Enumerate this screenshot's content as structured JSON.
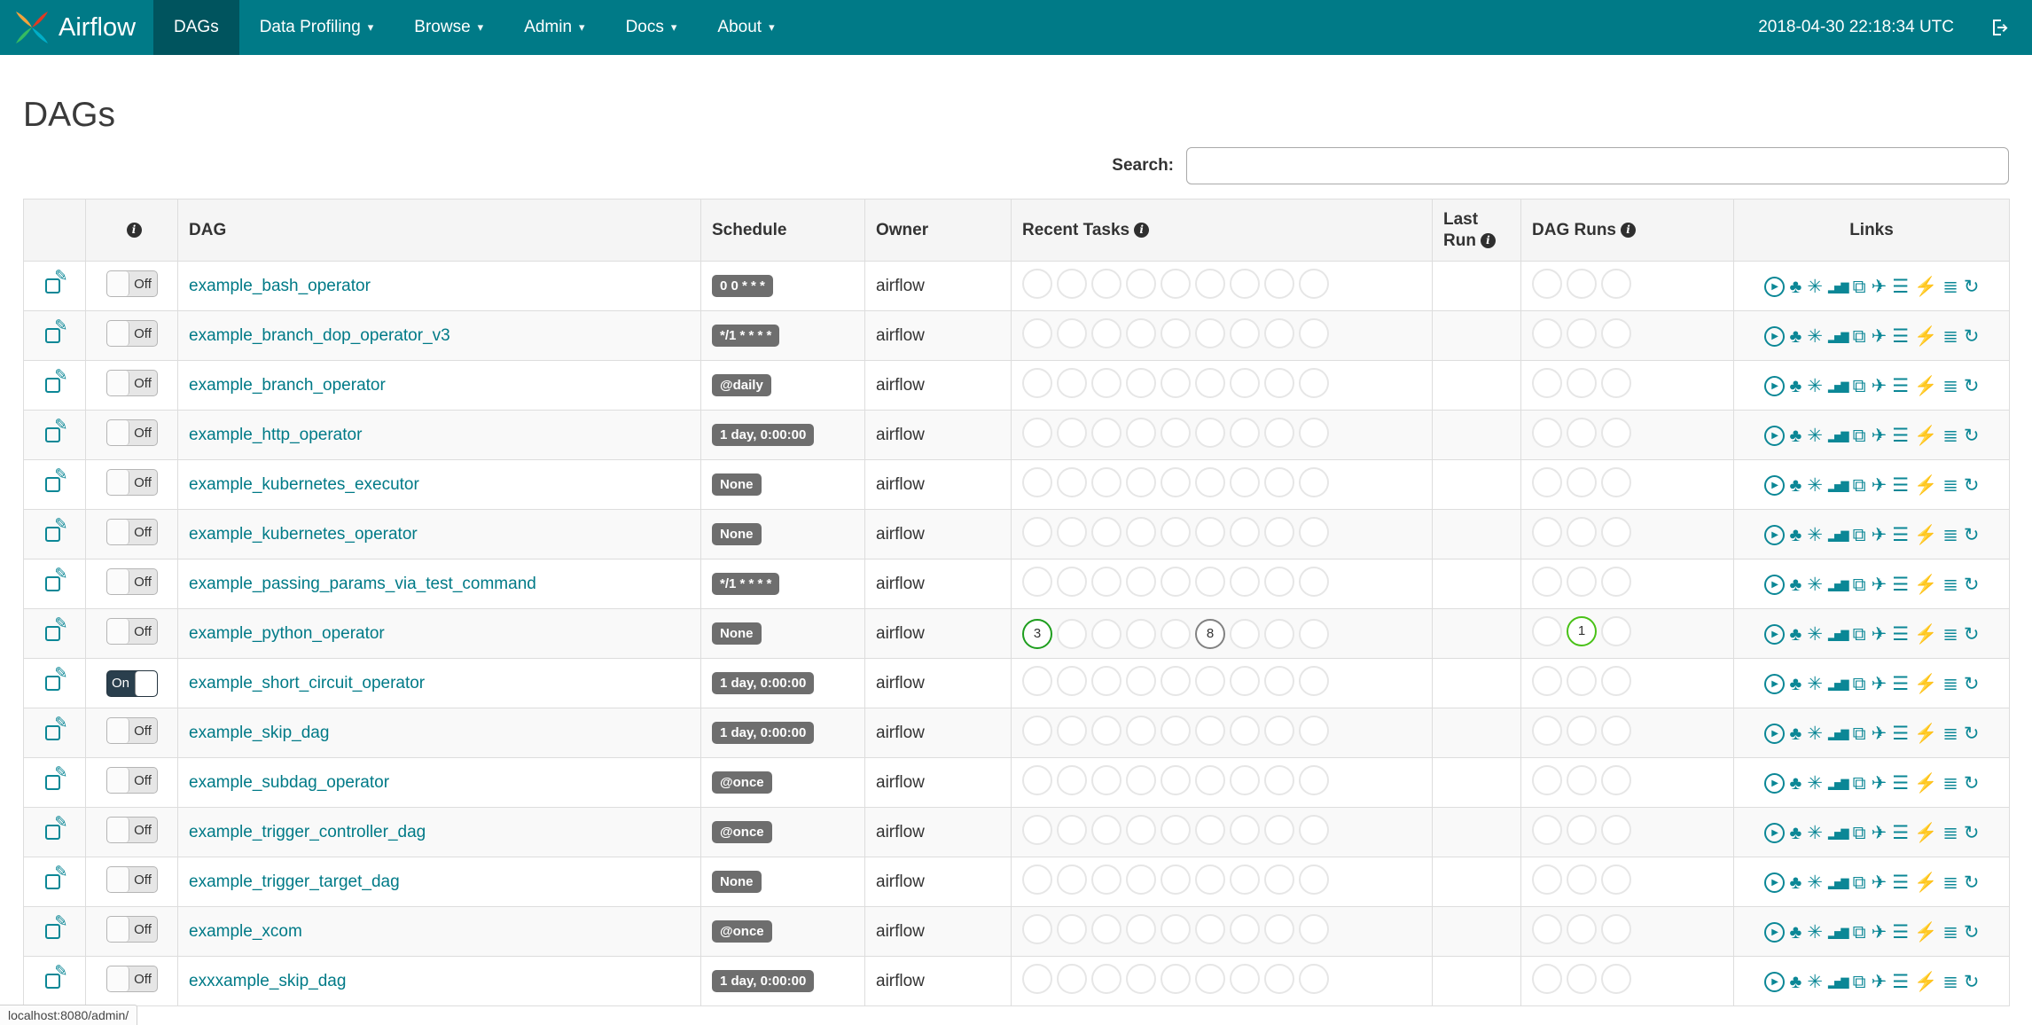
{
  "colors": {
    "navbar_bg": "#007A87",
    "navbar_active_bg": "#00545E",
    "link_teal": "#007A87",
    "icon_teal": "#0B8796",
    "badge_gray": "#6E6E6E",
    "toggle_on_bg": "#2A3F4D",
    "circle_empty_border": "#E6E6E6",
    "success_green": "#1E9E1E",
    "running_green": "#49C117",
    "queued_gray": "#828282"
  },
  "navbar": {
    "brand": "Airflow",
    "items": [
      {
        "label": "DAGs",
        "active": true,
        "dropdown": false
      },
      {
        "label": "Data Profiling",
        "active": false,
        "dropdown": true
      },
      {
        "label": "Browse",
        "active": false,
        "dropdown": true
      },
      {
        "label": "Admin",
        "active": false,
        "dropdown": true
      },
      {
        "label": "Docs",
        "active": false,
        "dropdown": true
      },
      {
        "label": "About",
        "active": false,
        "dropdown": true
      }
    ],
    "clock": "2018-04-30 22:18:34 UTC"
  },
  "page_title": "DAGs",
  "search": {
    "label": "Search:",
    "value": ""
  },
  "icons": {
    "info": "i",
    "caret": "▾",
    "edit": "✎"
  },
  "table": {
    "columns": [
      {
        "key": "edit",
        "label": "",
        "info": false
      },
      {
        "key": "toggle",
        "label": "",
        "info": true
      },
      {
        "key": "dag",
        "label": "DAG",
        "info": false
      },
      {
        "key": "schedule",
        "label": "Schedule",
        "info": false
      },
      {
        "key": "owner",
        "label": "Owner",
        "info": false
      },
      {
        "key": "recent",
        "label": "Recent Tasks",
        "info": true
      },
      {
        "key": "lastrun",
        "label": "Last Run",
        "info": true
      },
      {
        "key": "dagruns",
        "label": "DAG Runs",
        "info": true
      },
      {
        "key": "links",
        "label": "Links",
        "info": false
      }
    ],
    "recent_task_slots": 9,
    "dag_run_slots": 3,
    "link_icons": [
      {
        "name": "play-circle-icon",
        "glyph": "▶",
        "circled": true
      },
      {
        "name": "tree-icon",
        "glyph": "♣"
      },
      {
        "name": "graph-starburst-icon",
        "glyph": "✳"
      },
      {
        "name": "bar-chart-icon",
        "glyph": "▂▅▇",
        "small": true
      },
      {
        "name": "books-icon",
        "glyph": "⧉"
      },
      {
        "name": "plane-icon",
        "glyph": "✈"
      },
      {
        "name": "align-left-icon",
        "glyph": "☰"
      },
      {
        "name": "lightning-icon",
        "glyph": "⚡"
      },
      {
        "name": "list-lines-icon",
        "glyph": "≣"
      },
      {
        "name": "refresh-icon",
        "glyph": "↻"
      }
    ],
    "rows": [
      {
        "dag": "example_bash_operator",
        "toggle": "Off",
        "schedule": "0 0 * * *",
        "owner": "airflow",
        "recent_tasks": {},
        "dag_runs": {}
      },
      {
        "dag": "example_branch_dop_operator_v3",
        "toggle": "Off",
        "schedule": "*/1 * * * *",
        "owner": "airflow",
        "recent_tasks": {},
        "dag_runs": {}
      },
      {
        "dag": "example_branch_operator",
        "toggle": "Off",
        "schedule": "@daily",
        "owner": "airflow",
        "recent_tasks": {},
        "dag_runs": {}
      },
      {
        "dag": "example_http_operator",
        "toggle": "Off",
        "schedule": "1 day, 0:00:00",
        "owner": "airflow",
        "recent_tasks": {},
        "dag_runs": {}
      },
      {
        "dag": "example_kubernetes_executor",
        "toggle": "Off",
        "schedule": "None",
        "owner": "airflow",
        "recent_tasks": {},
        "dag_runs": {}
      },
      {
        "dag": "example_kubernetes_operator",
        "toggle": "Off",
        "schedule": "None",
        "owner": "airflow",
        "recent_tasks": {},
        "dag_runs": {}
      },
      {
        "dag": "example_passing_params_via_test_command",
        "toggle": "Off",
        "schedule": "*/1 * * * *",
        "owner": "airflow",
        "recent_tasks": {},
        "dag_runs": {}
      },
      {
        "dag": "example_python_operator",
        "toggle": "Off",
        "schedule": "None",
        "owner": "airflow",
        "recent_tasks": {
          "0": {
            "count": "3",
            "color": "#1E9E1E"
          },
          "5": {
            "count": "8",
            "color": "#828282"
          }
        },
        "dag_runs": {
          "1": {
            "count": "1",
            "color": "#49C117"
          }
        }
      },
      {
        "dag": "example_short_circuit_operator",
        "toggle": "On",
        "schedule": "1 day, 0:00:00",
        "owner": "airflow",
        "recent_tasks": {},
        "dag_runs": {}
      },
      {
        "dag": "example_skip_dag",
        "toggle": "Off",
        "schedule": "1 day, 0:00:00",
        "owner": "airflow",
        "recent_tasks": {},
        "dag_runs": {}
      },
      {
        "dag": "example_subdag_operator",
        "toggle": "Off",
        "schedule": "@once",
        "owner": "airflow",
        "recent_tasks": {},
        "dag_runs": {}
      },
      {
        "dag": "example_trigger_controller_dag",
        "toggle": "Off",
        "schedule": "@once",
        "owner": "airflow",
        "recent_tasks": {},
        "dag_runs": {}
      },
      {
        "dag": "example_trigger_target_dag",
        "toggle": "Off",
        "schedule": "None",
        "owner": "airflow",
        "recent_tasks": {},
        "dag_runs": {}
      },
      {
        "dag": "example_xcom",
        "toggle": "Off",
        "schedule": "@once",
        "owner": "airflow",
        "recent_tasks": {},
        "dag_runs": {}
      },
      {
        "dag": "exxxample_skip_dag",
        "toggle": "Off",
        "schedule": "1 day, 0:00:00",
        "owner": "airflow",
        "recent_tasks": {},
        "dag_runs": {}
      }
    ]
  },
  "status_bar": "localhost:8080/admin/"
}
